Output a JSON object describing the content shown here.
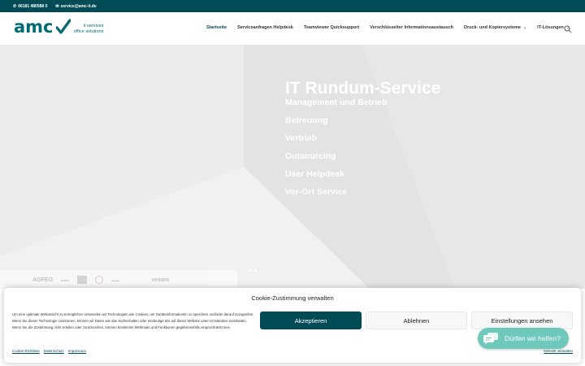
{
  "topbar": {
    "phone": "06181 480588 0",
    "email": "service@amc-it.de"
  },
  "logo": {
    "name": "amc",
    "line1": "it services",
    "line2": "office solutions"
  },
  "nav": {
    "items": [
      {
        "label": "Startseite",
        "active": true
      },
      {
        "label": "Serviceanfragen Helpdesk"
      },
      {
        "label": "Teamviewer Quicksupport"
      },
      {
        "label": "Verschlüsselter Informationsaustausch"
      },
      {
        "label": "Druck- und Kopiersysteme",
        "has_submenu": true
      },
      {
        "label": "IT-Lösungen",
        "has_submenu": true
      }
    ]
  },
  "hero": {
    "title": "IT Rundum-Service",
    "lines": [
      "Management und Betrieb",
      "Betreuung",
      "Vertrieb",
      "Outsourcing",
      "User Helpdesk",
      "Vor-Ort Service"
    ]
  },
  "partners": [
    "AGFEO",
    "datev",
    "veeam"
  ],
  "cookie": {
    "title": "Cookie-Zustimmung verwalten",
    "body": "Um eine optimale Webansicht zu ermöglichen verwenden wir Technologien wie Cookies, um Geräteinformationen zu speichern und/oder darauf zuzugreifen. Wenn Sie dieser Technologie zustimmen, können wir Daten wie das Surfverhalten oder eindeutige IDs auf dieser Website unter Umständen verarbeiten. Wenn Sie die Zustimmung nicht erteilen oder zurückziehen, können bestimmte Merkmale und Funktionen gegebenenfalls eingeschränkt sein.",
    "accept": "Akzeptieren",
    "deny": "Ablehnen",
    "settings": "Einstellungen ansehen",
    "links": [
      "Cookie-Richtlinie",
      "Datenschutz",
      "Impressum"
    ],
    "manage": "Dienste verwalten"
  },
  "chat": {
    "label": "Dürfen wir helfen?"
  },
  "colors": {
    "brand": "#004b56",
    "logo": "#006b73",
    "chat": "#6ec9bb"
  }
}
